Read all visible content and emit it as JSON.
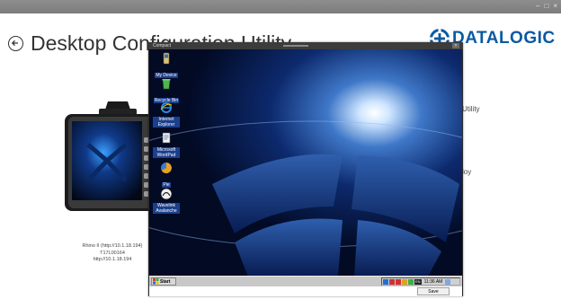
{
  "window": {
    "controls": [
      "–",
      "□",
      "×"
    ]
  },
  "header": {
    "title": "Desktop Configuration Utility"
  },
  "brand": {
    "name": "DATALOGIC",
    "color": "#0a5aa3"
  },
  "device": {
    "caption_line1": "Rhino II (http://10.1.18.194)",
    "caption_line2": "T17L00164",
    "caption_line3": "http://10.1.18.194"
  },
  "side_texts": {
    "text1": "Utility",
    "text2": "loy"
  },
  "remote": {
    "title": "Compact",
    "close_label": "×",
    "desktop_icons": [
      {
        "label": "My Device",
        "icon": "my-device-icon"
      },
      {
        "label": "Recycle Bin",
        "icon": "recycle-bin-icon"
      },
      {
        "label": "Internet Explorer",
        "icon": "internet-explorer-icon"
      },
      {
        "label": "Microsoft WordPad",
        "icon": "wordpad-icon"
      },
      {
        "label": "Pie",
        "icon": "pie-icon"
      },
      {
        "label": "Wavelink Avalanche",
        "icon": "wavelink-icon"
      }
    ],
    "taskbar": {
      "start_label": "Start",
      "time": "11:36 AM",
      "tray_badge": "EN"
    },
    "save_label": "Save"
  }
}
